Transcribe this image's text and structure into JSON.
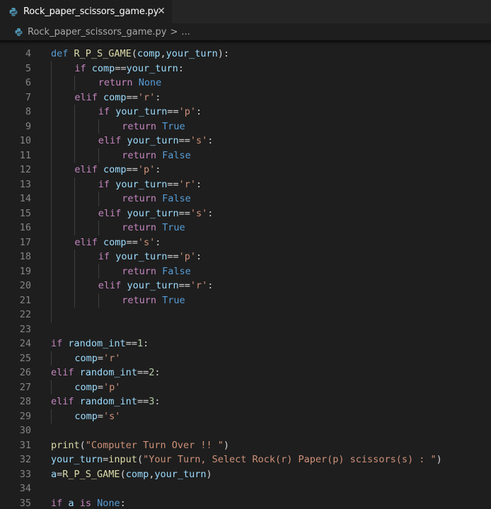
{
  "tab": {
    "title": "Rock_paper_scissors_game.py",
    "close_glyph": "✕",
    "icon": "python-file-icon"
  },
  "breadcrumb": {
    "file": "Rock_paper_scissors_game.py",
    "separator": ">",
    "more": "..."
  },
  "colors": {
    "keyword": "#c586c0",
    "def": "#569cd6",
    "function": "#dcdcaa",
    "variable": "#9cdcfe",
    "string": "#ce9178",
    "number": "#b5cea8",
    "line_number": "#858585",
    "background": "#1e1e1e"
  },
  "code_lines": [
    {
      "n": "4",
      "indent": 0,
      "tokens": [
        [
          "def",
          "def"
        ],
        [
          " ",
          ""
        ],
        [
          "R_P_S_GAME",
          "fn"
        ],
        [
          "(",
          ""
        ],
        [
          "comp",
          "var"
        ],
        [
          ",",
          ""
        ],
        [
          "your_turn",
          "var"
        ],
        [
          "):",
          ""
        ]
      ]
    },
    {
      "n": "5",
      "indent": 1,
      "tokens": [
        [
          "if",
          "kw"
        ],
        [
          " ",
          ""
        ],
        [
          "comp",
          "var"
        ],
        [
          "==",
          "op"
        ],
        [
          "your_turn",
          "var"
        ],
        [
          ":",
          ""
        ]
      ]
    },
    {
      "n": "6",
      "indent": 2,
      "tokens": [
        [
          "return",
          "kw"
        ],
        [
          " ",
          ""
        ],
        [
          "None",
          "const"
        ]
      ]
    },
    {
      "n": "7",
      "indent": 1,
      "tokens": [
        [
          "elif",
          "kw"
        ],
        [
          " ",
          ""
        ],
        [
          "comp",
          "var"
        ],
        [
          "==",
          "op"
        ],
        [
          "'r'",
          "str"
        ],
        [
          ":",
          ""
        ]
      ]
    },
    {
      "n": "8",
      "indent": 2,
      "tokens": [
        [
          "if",
          "kw"
        ],
        [
          " ",
          ""
        ],
        [
          "your_turn",
          "var"
        ],
        [
          "==",
          "op"
        ],
        [
          "'p'",
          "str"
        ],
        [
          ":",
          ""
        ]
      ]
    },
    {
      "n": "9",
      "indent": 3,
      "tokens": [
        [
          "return",
          "kw"
        ],
        [
          " ",
          ""
        ],
        [
          "True",
          "const"
        ]
      ]
    },
    {
      "n": "10",
      "indent": 2,
      "tokens": [
        [
          "elif",
          "kw"
        ],
        [
          " ",
          ""
        ],
        [
          "your_turn",
          "var"
        ],
        [
          "==",
          "op"
        ],
        [
          "'s'",
          "str"
        ],
        [
          ":",
          ""
        ]
      ]
    },
    {
      "n": "11",
      "indent": 3,
      "tokens": [
        [
          "return",
          "kw"
        ],
        [
          " ",
          ""
        ],
        [
          "False",
          "const"
        ]
      ]
    },
    {
      "n": "12",
      "indent": 1,
      "tokens": [
        [
          "elif",
          "kw"
        ],
        [
          " ",
          ""
        ],
        [
          "comp",
          "var"
        ],
        [
          "==",
          "op"
        ],
        [
          "'p'",
          "str"
        ],
        [
          ":",
          ""
        ]
      ]
    },
    {
      "n": "13",
      "indent": 2,
      "tokens": [
        [
          "if",
          "kw"
        ],
        [
          " ",
          ""
        ],
        [
          "your_turn",
          "var"
        ],
        [
          "==",
          "op"
        ],
        [
          "'r'",
          "str"
        ],
        [
          ":",
          ""
        ]
      ]
    },
    {
      "n": "14",
      "indent": 3,
      "tokens": [
        [
          "return",
          "kw"
        ],
        [
          " ",
          ""
        ],
        [
          "False",
          "const"
        ]
      ]
    },
    {
      "n": "15",
      "indent": 2,
      "tokens": [
        [
          "elif",
          "kw"
        ],
        [
          " ",
          ""
        ],
        [
          "your_turn",
          "var"
        ],
        [
          "==",
          "op"
        ],
        [
          "'s'",
          "str"
        ],
        [
          ":",
          ""
        ]
      ]
    },
    {
      "n": "16",
      "indent": 3,
      "tokens": [
        [
          "return",
          "kw"
        ],
        [
          " ",
          ""
        ],
        [
          "True",
          "const"
        ]
      ]
    },
    {
      "n": "17",
      "indent": 1,
      "tokens": [
        [
          "elif",
          "kw"
        ],
        [
          " ",
          ""
        ],
        [
          "comp",
          "var"
        ],
        [
          "==",
          "op"
        ],
        [
          "'s'",
          "str"
        ],
        [
          ":",
          ""
        ]
      ]
    },
    {
      "n": "18",
      "indent": 2,
      "tokens": [
        [
          "if",
          "kw"
        ],
        [
          " ",
          ""
        ],
        [
          "your_turn",
          "var"
        ],
        [
          "==",
          "op"
        ],
        [
          "'p'",
          "str"
        ],
        [
          ":",
          ""
        ]
      ]
    },
    {
      "n": "19",
      "indent": 3,
      "tokens": [
        [
          "return",
          "kw"
        ],
        [
          " ",
          ""
        ],
        [
          "False",
          "const"
        ]
      ]
    },
    {
      "n": "20",
      "indent": 2,
      "tokens": [
        [
          "elif",
          "kw"
        ],
        [
          " ",
          ""
        ],
        [
          "your_turn",
          "var"
        ],
        [
          "==",
          "op"
        ],
        [
          "'r'",
          "str"
        ],
        [
          ":",
          ""
        ]
      ]
    },
    {
      "n": "21",
      "indent": 3,
      "tokens": [
        [
          "return",
          "kw"
        ],
        [
          " ",
          ""
        ],
        [
          "True",
          "const"
        ]
      ]
    },
    {
      "n": "22",
      "indent": 1,
      "tokens": []
    },
    {
      "n": "23",
      "indent": 0,
      "tokens": []
    },
    {
      "n": "24",
      "indent": 0,
      "tokens": [
        [
          "if",
          "kw"
        ],
        [
          " ",
          ""
        ],
        [
          "random_int",
          "var"
        ],
        [
          "==",
          "op"
        ],
        [
          "1",
          "num"
        ],
        [
          ":",
          ""
        ]
      ]
    },
    {
      "n": "25",
      "indent": 1,
      "tokens": [
        [
          "comp",
          "var"
        ],
        [
          "=",
          "op"
        ],
        [
          "'r'",
          "str"
        ]
      ]
    },
    {
      "n": "26",
      "indent": 0,
      "tokens": [
        [
          "elif",
          "kw"
        ],
        [
          " ",
          ""
        ],
        [
          "random_int",
          "var"
        ],
        [
          "==",
          "op"
        ],
        [
          "2",
          "num"
        ],
        [
          ":",
          ""
        ]
      ]
    },
    {
      "n": "27",
      "indent": 1,
      "tokens": [
        [
          "comp",
          "var"
        ],
        [
          "=",
          "op"
        ],
        [
          "'p'",
          "str"
        ]
      ]
    },
    {
      "n": "28",
      "indent": 0,
      "tokens": [
        [
          "elif",
          "kw"
        ],
        [
          " ",
          ""
        ],
        [
          "random_int",
          "var"
        ],
        [
          "==",
          "op"
        ],
        [
          "3",
          "num"
        ],
        [
          ":",
          ""
        ]
      ]
    },
    {
      "n": "29",
      "indent": 1,
      "tokens": [
        [
          "comp",
          "var"
        ],
        [
          "=",
          "op"
        ],
        [
          "'s'",
          "str"
        ]
      ]
    },
    {
      "n": "30",
      "indent": 0,
      "tokens": []
    },
    {
      "n": "31",
      "indent": 0,
      "tokens": [
        [
          "print",
          "fn"
        ],
        [
          "(",
          ""
        ],
        [
          "\"Computer Turn Over !! \"",
          "str"
        ],
        [
          ")",
          ""
        ]
      ]
    },
    {
      "n": "32",
      "indent": 0,
      "tokens": [
        [
          "your_turn",
          "var"
        ],
        [
          "=",
          "op"
        ],
        [
          "input",
          "fn"
        ],
        [
          "(",
          ""
        ],
        [
          "\"Your Turn, Select Rock(r) Paper(p) scissors(s) : \"",
          "str"
        ],
        [
          ")",
          ""
        ]
      ]
    },
    {
      "n": "33",
      "indent": 0,
      "tokens": [
        [
          "a",
          "var"
        ],
        [
          "=",
          "op"
        ],
        [
          "R_P_S_GAME",
          "fn"
        ],
        [
          "(",
          ""
        ],
        [
          "comp",
          "var"
        ],
        [
          ",",
          ""
        ],
        [
          "your_turn",
          "var"
        ],
        [
          ")",
          ""
        ]
      ]
    },
    {
      "n": "34",
      "indent": 0,
      "tokens": []
    },
    {
      "n": "35",
      "indent": 0,
      "tokens": [
        [
          "if",
          "kw"
        ],
        [
          " ",
          ""
        ],
        [
          "a",
          "var"
        ],
        [
          " ",
          ""
        ],
        [
          "is",
          "kw"
        ],
        [
          " ",
          ""
        ],
        [
          "None",
          "const"
        ],
        [
          ":",
          ""
        ]
      ]
    }
  ]
}
